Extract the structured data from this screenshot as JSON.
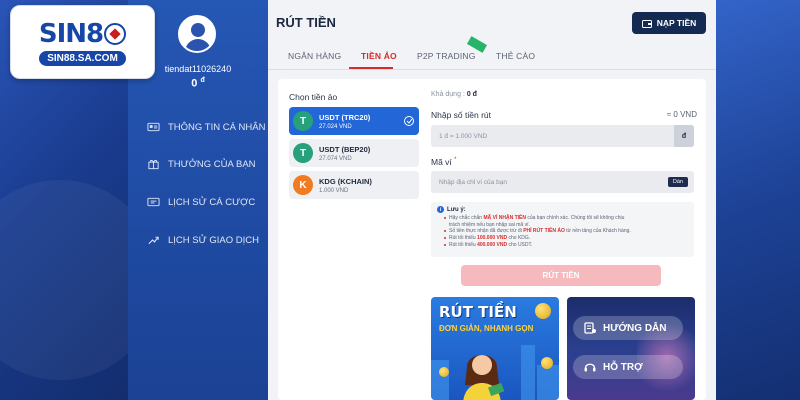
{
  "logo": {
    "brand": "SIN88",
    "domain": "SIN88.SA.COM"
  },
  "user": {
    "name": "tiendat11026240",
    "balance": "0",
    "currency_symbol": "đ"
  },
  "sidebar": {
    "items": [
      {
        "label": "THÔNG TIN CÁ NHÂN",
        "icon": "id-card-icon"
      },
      {
        "label": "THƯỞNG CỦA BẠN",
        "icon": "gift-icon"
      },
      {
        "label": "LỊCH SỬ CÁ CƯỢC",
        "icon": "ticket-icon"
      },
      {
        "label": "LỊCH SỬ GIAO DỊCH",
        "icon": "transaction-icon"
      }
    ]
  },
  "header": {
    "title": "RÚT TIỀN",
    "deposit_label": "NẠP TIỀN"
  },
  "tabs": [
    {
      "label": "NGÂN HÀNG",
      "active": false
    },
    {
      "label": "TIỀN ẢO",
      "active": true
    },
    {
      "label": "P2P TRADING",
      "active": false
    },
    {
      "label": "THẺ CÀO",
      "active": false
    }
  ],
  "crypto": {
    "label": "Chọn tiền ảo",
    "items": [
      {
        "name": "USDT (TRC20)",
        "rate": "27.024 VND",
        "icon": "usdt-icon",
        "selected": true
      },
      {
        "name": "USDT (BEP20)",
        "rate": "27.074 VND",
        "icon": "usdt-icon",
        "selected": false
      },
      {
        "name": "KDG (KCHAIN)",
        "rate": "1.000 VND",
        "icon": "kdg-icon",
        "selected": false
      }
    ]
  },
  "form": {
    "available_label": "Khả dụng :",
    "available_value": "0 đ",
    "amount_label": "Nhập số tiền rút",
    "amount_conversion": "≈ 0 VND",
    "amount_placeholder": "1 đ = 1.000 VND",
    "amount_unit": "đ",
    "wallet_label": "Mã ví",
    "wallet_required": "*",
    "wallet_placeholder": "Nhập địa chỉ ví của bạn",
    "paste_label": "Dán"
  },
  "notes": {
    "heading": "Lưu ý:",
    "lines": [
      {
        "pre": "Hãy chắc chắn ",
        "hl": "MÃ VÍ NHẬN TIỀN",
        "post": " của bạn chính xác. Chúng tôi sẽ không chịu"
      },
      {
        "pre": "trách nhiệm nếu bạn nhập sai mã ví.",
        "hl": "",
        "post": ""
      },
      {
        "pre": "Số tiền thực nhận đã được trừ đi ",
        "hl": "PHÍ RÚT TIỀN ẢO",
        "post": " từ nền tảng của Khách hàng."
      },
      {
        "pre": "Rút tối thiểu ",
        "hl": "100.000 VND",
        "post": " cho KDG."
      },
      {
        "pre": "Rút tối thiểu ",
        "hl": "400.000 VND",
        "post": " cho USDT."
      }
    ]
  },
  "withdraw_button": "RÚT TIỀN",
  "banner_left": {
    "title": "RÚT TIỀN",
    "subtitle": "ĐƠN GIẢN, NHANH GỌN"
  },
  "banner_right": {
    "guide_label": "HƯỚNG DẪN",
    "support_label": "HỖ TRỢ"
  },
  "colors": {
    "accent_red": "#d72a2a",
    "selected_blue": "#2266d8",
    "dark_navy": "#152a52",
    "sidebar_blue": "#2557b4"
  }
}
